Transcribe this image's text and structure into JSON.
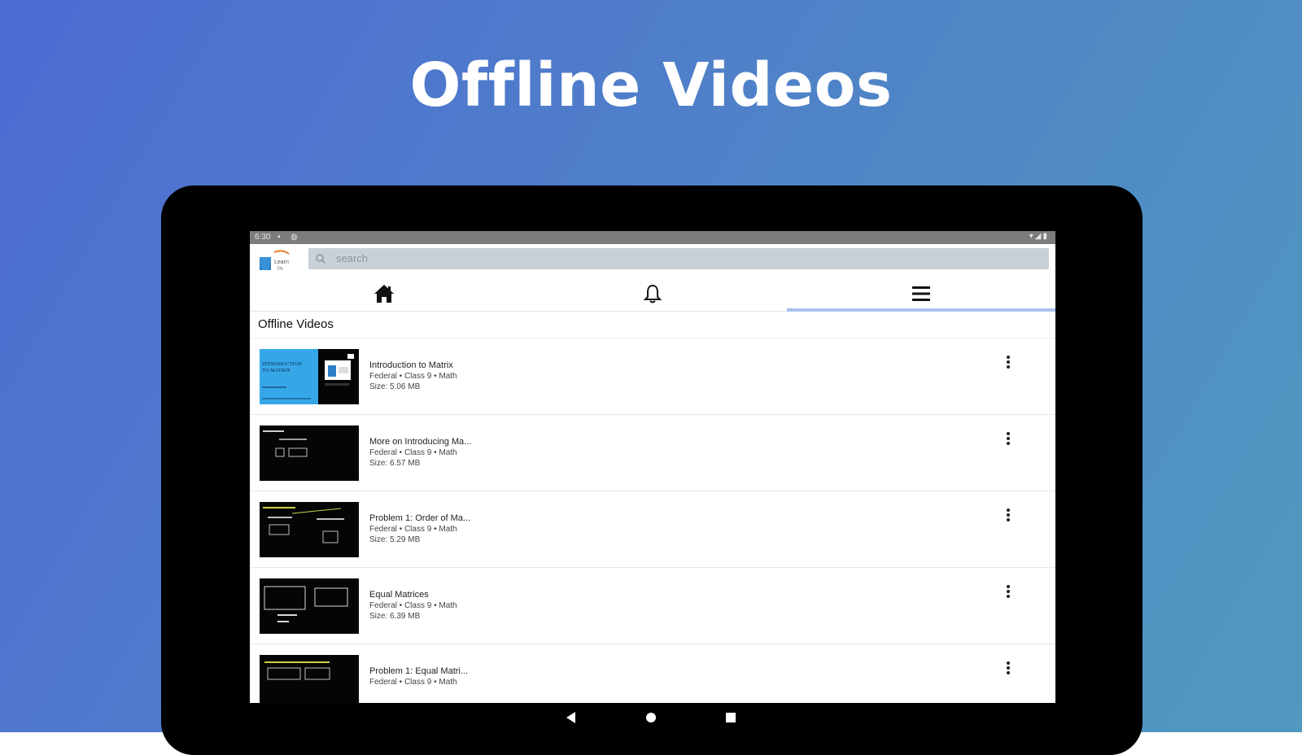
{
  "headline": "Offline Videos",
  "status": {
    "time": "6:30"
  },
  "search": {
    "placeholder": "search"
  },
  "tabs": {
    "home": "home-icon",
    "notifications": "bell-icon",
    "menu": "menu-icon",
    "selected": "menu"
  },
  "section_title": "Offline Videos",
  "videos": [
    {
      "title": "Introduction to Matrix",
      "meta": "Federal • Class 9 • Math",
      "size": "Size: 5.06 MB",
      "thumb_text_1": "INTRODUCTION",
      "thumb_text_2": "TO MATRIX"
    },
    {
      "title": "More on Introducing Ma...",
      "meta": "Federal • Class 9 • Math",
      "size": "Size: 6.57 MB"
    },
    {
      "title": "Problem 1: Order of Ma...",
      "meta": "Federal • Class 9 • Math",
      "size": "Size: 5.29 MB"
    },
    {
      "title": "Equal Matrices",
      "meta": "Federal • Class 9 • Math",
      "size": "Size: 6.39 MB"
    },
    {
      "title": "Problem 1: Equal Matri...",
      "meta": "Federal • Class 9 • Math"
    }
  ],
  "colors": {
    "accent_indicator": "#a9c1ef",
    "search_bg": "#c9d0d8",
    "status_bar": "#7c7c7c"
  }
}
